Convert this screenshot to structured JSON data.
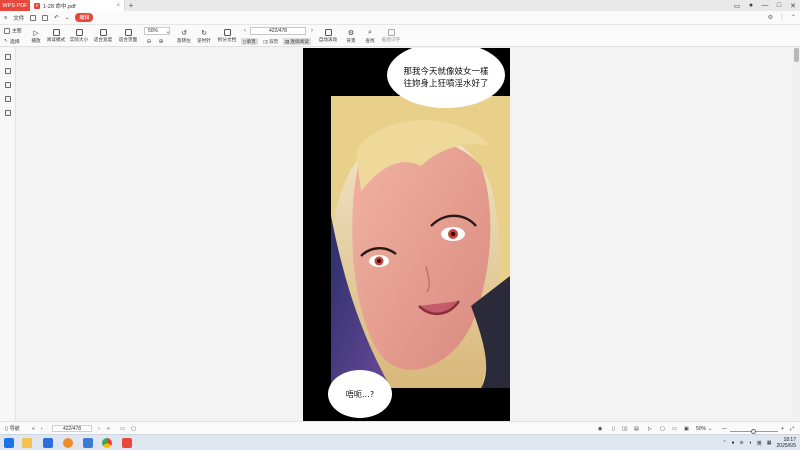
{
  "titlebar": {
    "brand": "WPS PDF",
    "tab_title": "1-28 命中.pdf",
    "new_tab": "+",
    "close_glyph": "×"
  },
  "menu": {
    "file": "文件",
    "edit_pill": "编辑"
  },
  "toolbar": {
    "mode_label": "主图",
    "select_label": "选择",
    "play_label": "播放",
    "read_mode_label": "阅读模式",
    "actual_size_label": "实际大小",
    "fit_width_label": "适合宽度",
    "fit_page_label": "适合页面",
    "zoom_value": "50%",
    "rotate_left_label": "旋转左",
    "rotate_right_label": "逆时针",
    "split_doc_label": "拆分文档",
    "page_value": "422/478",
    "single_page_label": "单页",
    "double_page_label": "双页",
    "continuous_label": "连续阅读",
    "auto_scroll_label": "自动滚动",
    "background_label": "背景",
    "search_label": "查找",
    "screen_capture_label": "截图识字"
  },
  "document": {
    "bubble_top_line1": "那我今天就像妓女一樣",
    "bubble_top_line2": "往妳身上狂噴淫水好了",
    "bubble_bottom": "唔呃…?",
    "art_colors": {
      "hair": "#e9d08a",
      "skin": "#e9a79a",
      "shadow": "#4a3a7a",
      "eyes": "#c4473c"
    }
  },
  "statusbar": {
    "nav_label": "导航",
    "page_value": "422/478",
    "zoom_value": "50%",
    "zoom_level": 0.5
  },
  "taskbar": {
    "time": "18:17",
    "date": "2025/6/5",
    "lang": "英"
  }
}
